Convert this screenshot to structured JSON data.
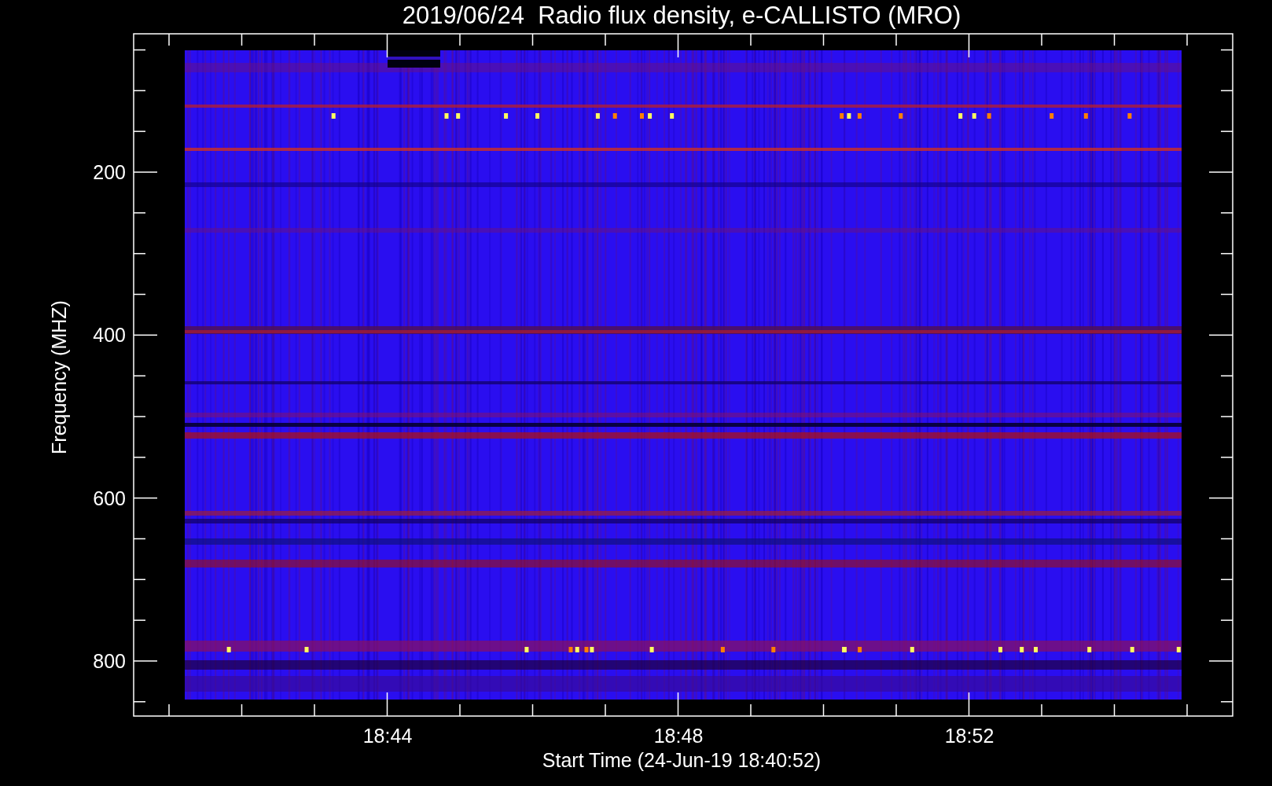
{
  "title": "2019/06/24  Radio flux density, e-CALLISTO (MRO)",
  "y_axis": {
    "label": "Frequency (MHZ)",
    "ticks": [
      "200",
      "400",
      "600",
      "800"
    ]
  },
  "x_axis": {
    "label": "Start Time (24-Jun-19 18:40:52)",
    "ticks": [
      "18:44",
      "18:48",
      "18:52"
    ]
  }
}
